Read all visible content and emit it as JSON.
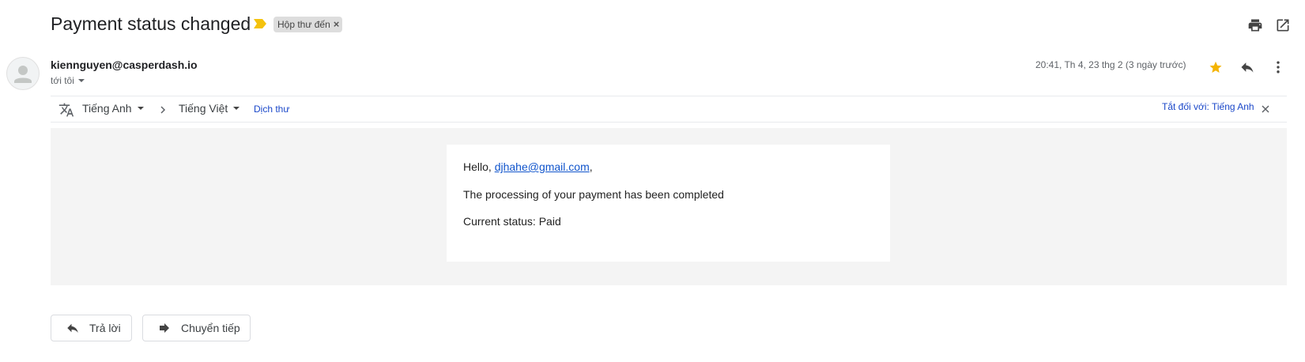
{
  "email": {
    "subject": "Payment status changed",
    "label": "Hộp thư đến",
    "sender": "kiennguyen@casperdash.io",
    "recipient_label": "tới tôi",
    "date": "20:41, Th 4, 23 thg 2 (3 ngày trước)"
  },
  "translation": {
    "source_language": "Tiếng Anh",
    "target_language": "Tiếng Việt",
    "translate_link": "Dịch thư",
    "turn_off_link": "Tắt đối với: Tiếng Anh"
  },
  "message": {
    "greeting_prefix": "Hello, ",
    "email_link": "djhahe@gmail.com",
    "greeting_suffix": ",",
    "line2": "The processing of your payment has been completed",
    "line3": "Current status: Paid"
  },
  "actions": {
    "reply_label": "Trả lời",
    "forward_label": "Chuyển tiếp"
  },
  "colors": {
    "importance_marker": "#f4c20d",
    "star": "#f4b400",
    "link": "#1a47c9"
  },
  "icons": [
    "importance-marker-icon",
    "close-icon",
    "print-icon",
    "open-in-new-window-icon",
    "avatar-person-icon",
    "caret-down-icon",
    "star-icon",
    "reply-icon",
    "more-vert-icon",
    "translate-icon",
    "chevron-right-icon",
    "forward-icon"
  ]
}
